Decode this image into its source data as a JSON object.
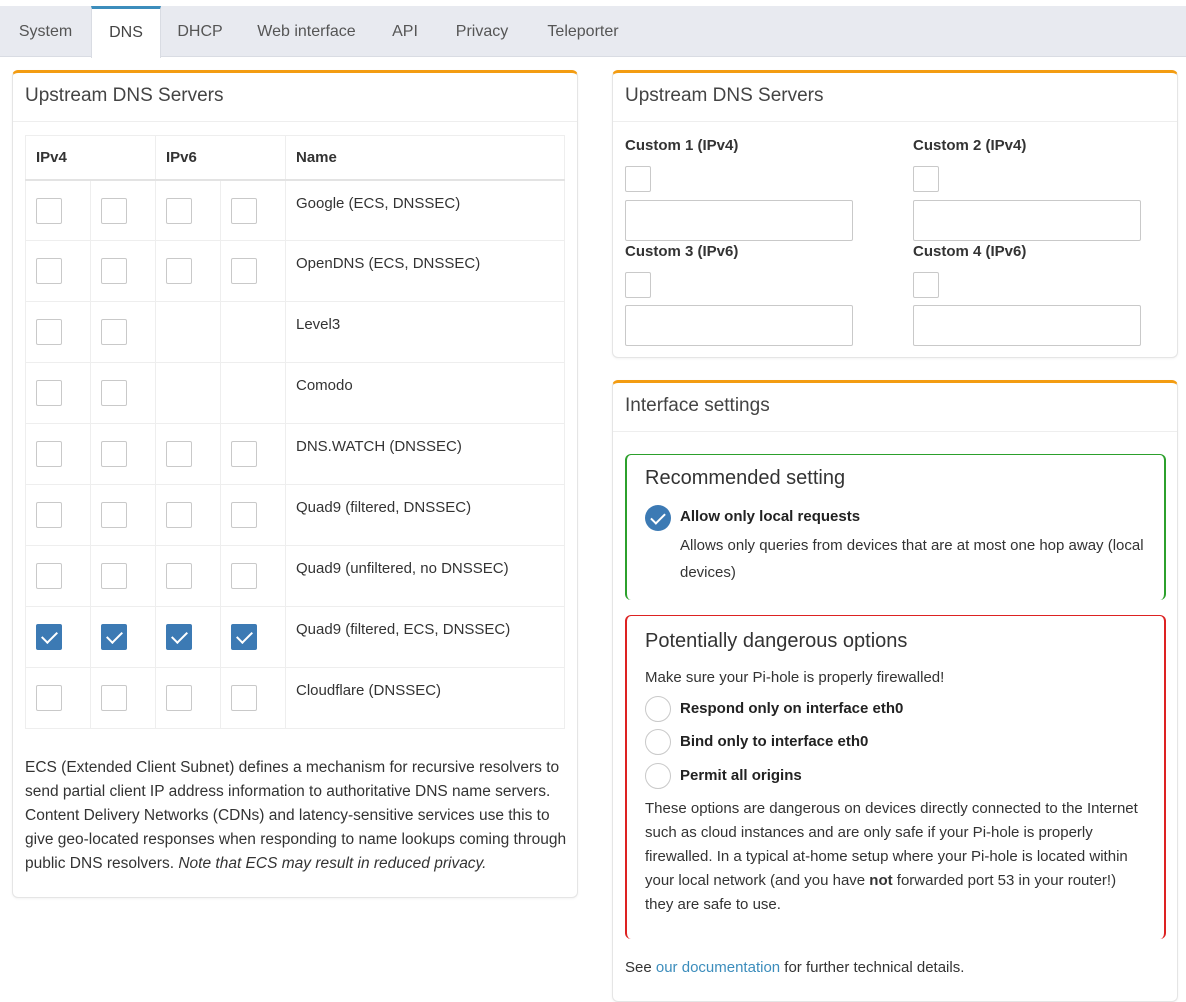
{
  "tabs": [
    "System",
    "DNS",
    "DHCP",
    "Web interface",
    "API",
    "Privacy",
    "Teleporter"
  ],
  "active_tab": "DNS",
  "left_box": {
    "title": "Upstream DNS Servers",
    "headers": {
      "ipv4": "IPv4",
      "ipv6": "IPv6",
      "name": "Name"
    },
    "rows": [
      {
        "name": "Google (ECS, DNSSEC)",
        "checks": [
          false,
          false,
          false,
          false
        ]
      },
      {
        "name": "OpenDNS (ECS, DNSSEC)",
        "checks": [
          false,
          false,
          false,
          false
        ]
      },
      {
        "name": "Level3",
        "checks": [
          false,
          false,
          null,
          null
        ]
      },
      {
        "name": "Comodo",
        "checks": [
          false,
          false,
          null,
          null
        ]
      },
      {
        "name": "DNS.WATCH (DNSSEC)",
        "checks": [
          false,
          false,
          false,
          false
        ]
      },
      {
        "name": "Quad9 (filtered, DNSSEC)",
        "checks": [
          false,
          false,
          false,
          false
        ]
      },
      {
        "name": "Quad9 (unfiltered, no DNSSEC)",
        "checks": [
          false,
          false,
          false,
          false
        ]
      },
      {
        "name": "Quad9 (filtered, ECS, DNSSEC)",
        "checks": [
          true,
          true,
          true,
          true
        ]
      },
      {
        "name": "Cloudflare (DNSSEC)",
        "checks": [
          false,
          false,
          false,
          false
        ]
      }
    ],
    "ecs_text": "ECS (Extended Client Subnet) defines a mechanism for recursive resolvers to send partial client IP address information to authoritative DNS name servers. Content Delivery Networks (CDNs) and latency-sensitive services use this to give geo-located responses when responding to name lookups coming through public DNS resolvers.",
    "ecs_note": "Note that ECS may result in reduced privacy."
  },
  "custom_box": {
    "title": "Upstream DNS Servers",
    "custom1": "Custom 1 (IPv4)",
    "custom2": "Custom 2 (IPv4)",
    "custom3": "Custom 3 (IPv6)",
    "custom4": "Custom 4 (IPv6)"
  },
  "interface_box": {
    "title": "Interface settings",
    "recommended_title": "Recommended setting",
    "allow_local_label": "Allow only local requests",
    "allow_local_desc": "Allows only queries from devices that are at most one hop away (local devices)",
    "danger_title": "Potentially dangerous options",
    "danger_intro": "Make sure your Pi-hole is properly firewalled!",
    "opt1": "Respond only on interface eth0",
    "opt2": "Bind only to interface eth0",
    "opt3": "Permit all origins",
    "danger_text_1": "These options are dangerous on devices directly connected to the Internet such as cloud instances and are only safe if your Pi-hole is properly firewalled. In a typical at-home setup where your Pi-hole is located within your local network (and you have",
    "danger_not": "not",
    "danger_text_2": "forwarded port 53 in your router!) they are safe to use.",
    "see": "See",
    "doc_link": "our documentation",
    "see_rest": "for further technical details."
  },
  "colors": {
    "accent": "#f39c12",
    "checkbox": "#3c7ab4",
    "green": "#2ca02c",
    "red": "#dd2222",
    "link": "#3c8dbc"
  }
}
